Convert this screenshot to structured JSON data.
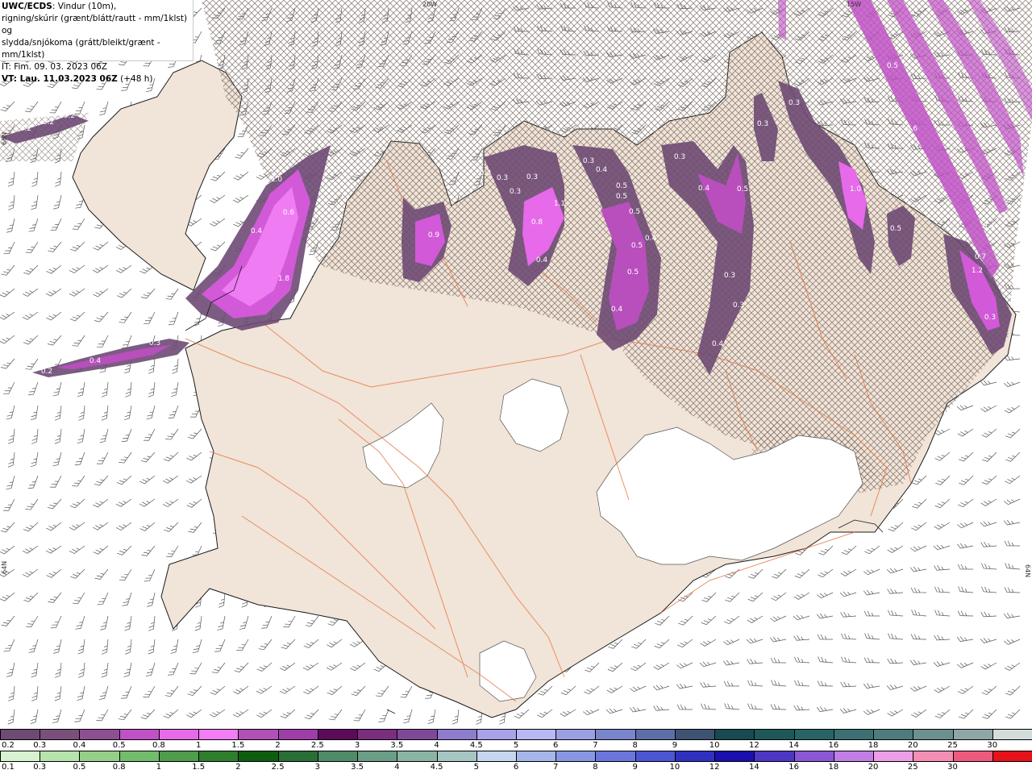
{
  "header": {
    "line1_bold": "UWC/ECDS",
    "line1_rest": ": Vindur (10m),",
    "line2": "rigning/skúrir (grænt/blátt/rautt - mm/1klst) og",
    "line3": "slydda/snjókoma (grátt/bleikt/grænt - mm/1klst)",
    "line4": "IT: Fim. 09. 03. 2023 06Z",
    "line5_bold": "VT: Lau. 11.03.2023 06Z",
    "line5_rest": " (+48 h)"
  },
  "graticule": {
    "lon_top": "20W",
    "lon_top_right": "15W",
    "lat_left_top": "66N",
    "lat_left_mid": "64N",
    "lat_right_mid": "64N"
  },
  "precip_labels": [
    "0.2",
    "0.2",
    "0.2",
    "1.0",
    "0.6",
    "0.4",
    "1.8",
    "0.3",
    "0.4",
    "0.2",
    "0.9",
    "0.3",
    "0.3",
    "0.3",
    "0.3",
    "0.8",
    "1.1",
    "0.4",
    "0.3",
    "0.4",
    "0.5",
    "0.5",
    "0.5",
    "0.4",
    "0.5",
    "0.5",
    "0.4",
    "0.3",
    "0.4",
    "0.5",
    "0.3",
    "0.3",
    "0.4",
    "0.3",
    "1.0",
    "0.5",
    "0.3",
    "0.7",
    "1.2",
    "0.3",
    "0.5",
    "0.6",
    "1.5",
    "0.4"
  ],
  "legend_snow": {
    "labels": [
      "0.2",
      "0.3",
      "0.4",
      "0.5",
      "0.8",
      "1",
      "1.5",
      "2",
      "2.5",
      "3",
      "3.5",
      "4",
      "4.5",
      "5",
      "6",
      "7",
      "8",
      "9",
      "10",
      "12",
      "14",
      "16",
      "18",
      "20",
      "25",
      "30"
    ],
    "colors": [
      "#6e4a74",
      "#7a4f7c",
      "#8d4f92",
      "#c052c6",
      "#e66ae9",
      "#f27df5",
      "#b150b6",
      "#a03ea8",
      "#5c0a5a",
      "#7a2e7e",
      "#7e4a98",
      "#8e7ccc",
      "#a8a2e8",
      "#b8b8f4",
      "#9aa0e2",
      "#7a86cc",
      "#5e6ea6",
      "#3e5272",
      "#184a52",
      "#1e5858",
      "#286466",
      "#3c7072",
      "#4e7c7c",
      "#6c9090",
      "#8ea6a6",
      "#d4dcdc"
    ]
  },
  "legend_rain": {
    "labels": [
      "0.1",
      "0.3",
      "0.5",
      "0.8",
      "1",
      "1.5",
      "2",
      "2.5",
      "3",
      "3.5",
      "4",
      "4.5",
      "5",
      "6",
      "7",
      "8",
      "9",
      "10",
      "12",
      "14",
      "16",
      "18",
      "20",
      "25",
      "30"
    ],
    "colors": [
      "#d6f2d0",
      "#b6e4ac",
      "#94d08a",
      "#72bc6c",
      "#4e9c4c",
      "#2e7e2e",
      "#0e5e10",
      "#2a6e38",
      "#4e8c68",
      "#6a9e86",
      "#8ab4a4",
      "#a6c6c2",
      "#c6d6ee",
      "#a6b6ea",
      "#8896e4",
      "#6a76dc",
      "#4c56d2",
      "#3030c2",
      "#1a10b0",
      "#4e36c6",
      "#8a58d6",
      "#c07ee6",
      "#ee9ee8",
      "#f48eb4",
      "#ee5a7e",
      "#e8121a"
    ]
  }
}
